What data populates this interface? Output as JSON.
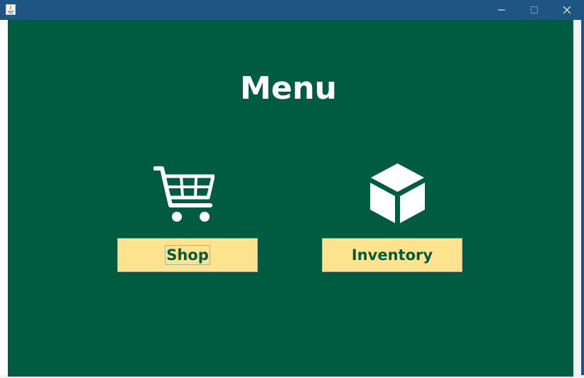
{
  "window": {
    "titlebar_color": "#1f5582",
    "controls": {
      "minimize_icon": "minimize-icon",
      "maximize_icon": "maximize-icon",
      "close_icon": "close-icon"
    }
  },
  "colors": {
    "background": "#005c40",
    "button_background": "#ffe38e",
    "button_text": "#005c40",
    "title_text": "#ffffff"
  },
  "menu": {
    "title": "Menu",
    "items": [
      {
        "label": "Shop",
        "icon": "shopping-cart-icon",
        "focused": true
      },
      {
        "label": "Inventory",
        "icon": "cube-icon",
        "focused": false
      }
    ]
  }
}
